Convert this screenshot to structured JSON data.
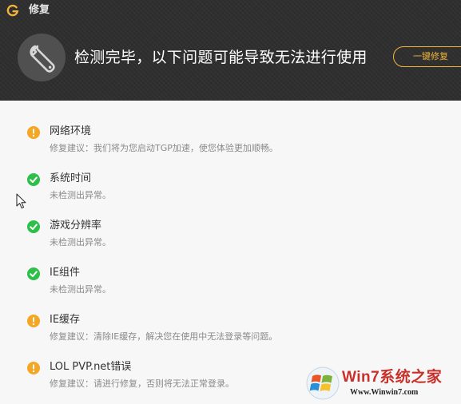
{
  "app": {
    "title": "修复"
  },
  "header": {
    "headline": "检测完毕，以下问题可能导致无法进行使用",
    "fix_button": "一键修复",
    "accent_color": "#f2b53a"
  },
  "items": [
    {
      "status": "warning",
      "title": "网络环境",
      "desc": "修复建议：我们将为您启动TGP加速，使您体验更加顺畅。"
    },
    {
      "status": "ok",
      "title": "系统时间",
      "desc": "未检测出异常。"
    },
    {
      "status": "ok",
      "title": "游戏分辨率",
      "desc": "未检测出异常。"
    },
    {
      "status": "ok",
      "title": "IE组件",
      "desc": "未检测出异常。"
    },
    {
      "status": "warning",
      "title": "IE缓存",
      "desc": "修复建议：清除IE缓存，解决您在使用中无法登录等问题。"
    },
    {
      "status": "warning",
      "title": "LOL PVP.net错误",
      "desc": "修复建议：请进行修复，否则将无法正常登录。"
    }
  ],
  "icons": {
    "logo": "g-logo-icon",
    "header": "wrench-icon",
    "warning": "exclamation-icon",
    "ok": "checkmark-icon"
  },
  "colors": {
    "warning": "#f5a623",
    "ok": "#2dbf4a",
    "header_bg": "#2f2f2f"
  },
  "watermark": {
    "brand": "Win7系统之家",
    "url": "Www.Winwin7.com"
  }
}
